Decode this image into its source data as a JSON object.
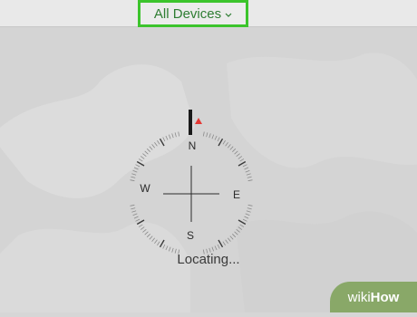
{
  "header": {
    "devices_label": "All Devices",
    "chevron_icon": "chevron-down-icon"
  },
  "compass": {
    "north": "N",
    "south": "S",
    "east": "E",
    "west": "W",
    "needle_color": "#e53935"
  },
  "status": {
    "text": "Locating..."
  },
  "watermark": {
    "wiki": "wiki",
    "how": "How"
  },
  "colors": {
    "highlight": "#3cc42c",
    "label": "#2e7d32",
    "background": "#d6d6d6"
  }
}
